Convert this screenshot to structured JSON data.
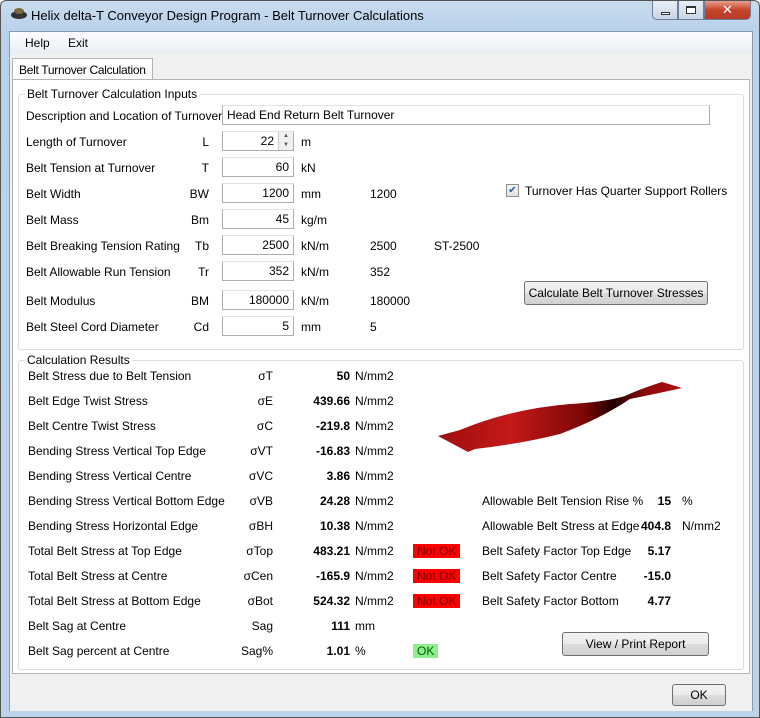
{
  "window": {
    "title": "Helix delta-T Conveyor Design Program - Belt Turnover Calculations",
    "min_icon": "minimize-icon",
    "max_icon": "maximize-icon",
    "close_icon": "close-icon"
  },
  "menu": {
    "help": "Help",
    "exit": "Exit"
  },
  "tab": {
    "label": "Belt Turnover Calculation"
  },
  "inputs": {
    "group_label": "Belt Turnover Calculation Inputs",
    "description": {
      "label": "Description and Location of Turnover",
      "value": "Head End Return Belt Turnover"
    },
    "rows": [
      {
        "label": "Length of Turnover",
        "sym": "L",
        "value": "22",
        "unit": "m",
        "extra": "",
        "extra2": ""
      },
      {
        "label": "Belt Tension at Turnover",
        "sym": "T",
        "value": "60",
        "unit": "kN",
        "extra": "",
        "extra2": ""
      },
      {
        "label": "Belt Width",
        "sym": "BW",
        "value": "1200",
        "unit": "mm",
        "extra": "1200",
        "extra2": ""
      },
      {
        "label": "Belt Mass",
        "sym": "Bm",
        "value": "45",
        "unit": "kg/m",
        "extra": "",
        "extra2": ""
      },
      {
        "label": "Belt Breaking Tension Rating",
        "sym": "Tb",
        "value": "2500",
        "unit": "kN/m",
        "extra": "2500",
        "extra2": "ST-2500"
      },
      {
        "label": "Belt Allowable Run Tension",
        "sym": "Tr",
        "value": "352",
        "unit": "kN/m",
        "extra": "352",
        "extra2": ""
      },
      {
        "label": "Belt Modulus",
        "sym": "BM",
        "value": "180000",
        "unit": "kN/m",
        "extra": "180000",
        "extra2": ""
      },
      {
        "label": "Belt Steel Cord Diameter",
        "sym": "Cd",
        "value": "5",
        "unit": "mm",
        "extra": "5",
        "extra2": ""
      }
    ],
    "checkbox": {
      "label": "Turnover Has Quarter Support Rollers",
      "checked": true
    },
    "calc_button": "Calculate Belt Turnover Stresses"
  },
  "results": {
    "group_label": "Calculation Results",
    "rows": [
      {
        "label": "Belt Stress due to Belt Tension",
        "sym": "σT",
        "value": "50",
        "unit": "N/mm2",
        "status": ""
      },
      {
        "label": "Belt Edge Twist Stress",
        "sym": "σE",
        "value": "439.66",
        "unit": "N/mm2",
        "status": ""
      },
      {
        "label": "Belt Centre Twist Stress",
        "sym": "σC",
        "value": "-219.8",
        "unit": "N/mm2",
        "status": ""
      },
      {
        "label": "Bending Stress Vertical Top Edge",
        "sym": "σVT",
        "value": "-16.83",
        "unit": "N/mm2",
        "status": ""
      },
      {
        "label": "Bending Stress Vertical Centre",
        "sym": "σVC",
        "value": "3.86",
        "unit": "N/mm2",
        "status": ""
      },
      {
        "label": "Bending Stress Vertical Bottom Edge",
        "sym": "σVB",
        "value": "24.28",
        "unit": "N/mm2",
        "status": ""
      },
      {
        "label": "Bending Stress Horizontal Edge",
        "sym": "σBH",
        "value": "10.38",
        "unit": "N/mm2",
        "status": ""
      },
      {
        "label": "Total Belt Stress at Top Edge",
        "sym": "σTop",
        "value": "483.21",
        "unit": "N/mm2",
        "status": "Not OK"
      },
      {
        "label": "Total Belt Stress at Centre",
        "sym": "σCen",
        "value": "-165.9",
        "unit": "N/mm2",
        "status": "Not OK"
      },
      {
        "label": "Total Belt Stress at Bottom Edge",
        "sym": "σBot",
        "value": "524.32",
        "unit": "N/mm2",
        "status": "Not OK"
      },
      {
        "label": "Belt Sag at Centre",
        "sym": "Sag",
        "value": "111",
        "unit": "mm",
        "status": ""
      },
      {
        "label": "Belt Sag percent at Centre",
        "sym": "Sag%",
        "value": "1.01",
        "unit": "%",
        "status": "OK"
      }
    ],
    "right": [
      {
        "label": "Allowable Belt Tension Rise %",
        "value": "15",
        "unit": "%"
      },
      {
        "label": "Allowable Belt Stress at Edge",
        "value": "404.8",
        "unit": "N/mm2"
      },
      {
        "label": "Belt Safety Factor Top Edge",
        "value": "5.17",
        "unit": ""
      },
      {
        "label": "Belt Safety Factor Centre",
        "value": "-15.0",
        "unit": ""
      },
      {
        "label": "Belt Safety Factor Bottom",
        "value": "4.77",
        "unit": ""
      }
    ],
    "report_button": "View / Print Report",
    "colors": {
      "not_ok": "#ff0000",
      "ok": "#90ee90",
      "belt": "#b01010"
    }
  },
  "ok_button": "OK"
}
